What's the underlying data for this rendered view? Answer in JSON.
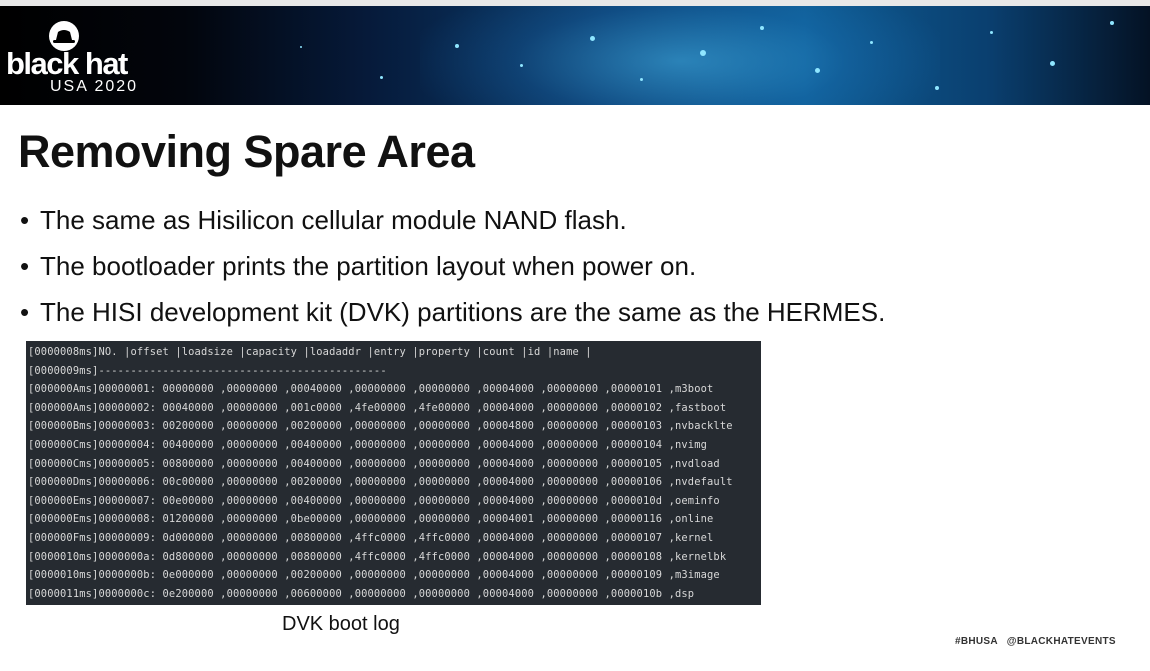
{
  "header": {
    "logo_wordmark": "black hat",
    "logo_event": "USA 2020",
    "logo_icon": "blackhat-hat-icon"
  },
  "slide": {
    "title": "Removing Spare Area",
    "bullets": [
      "The same as Hisilicon cellular module NAND flash.",
      "The bootloader prints the partition layout when power on.",
      "The HISI development kit (DVK) partitions are the same as the HERMES."
    ],
    "bullet_glyph": "•",
    "log_lines": [
      "[0000008ms]NO. |offset |loadsize |capacity |loadaddr |entry |property |count |id |name |",
      "[0000009ms]---------------------------------------------",
      "[000000Ams]00000001: 00000000 ,00000000 ,00040000 ,00000000 ,00000000 ,00004000 ,00000000 ,00000101 ,m3boot",
      "[000000Ams]00000002: 00040000 ,00000000 ,001c0000 ,4fe00000 ,4fe00000 ,00004000 ,00000000 ,00000102 ,fastboot",
      "[000000Bms]00000003: 00200000 ,00000000 ,00200000 ,00000000 ,00000000 ,00004800 ,00000000 ,00000103 ,nvbacklte",
      "[000000Cms]00000004: 00400000 ,00000000 ,00400000 ,00000000 ,00000000 ,00004000 ,00000000 ,00000104 ,nvimg",
      "[000000Cms]00000005: 00800000 ,00000000 ,00400000 ,00000000 ,00000000 ,00004000 ,00000000 ,00000105 ,nvdload",
      "[000000Dms]00000006: 00c00000 ,00000000 ,00200000 ,00000000 ,00000000 ,00004000 ,00000000 ,00000106 ,nvdefault",
      "[000000Ems]00000007: 00e00000 ,00000000 ,00400000 ,00000000 ,00000000 ,00004000 ,00000000 ,0000010d ,oeminfo",
      "[000000Ems]00000008: 01200000 ,00000000 ,0be00000 ,00000000 ,00000000 ,00004001 ,00000000 ,00000116 ,online",
      "[000000Fms]00000009: 0d000000 ,00000000 ,00800000 ,4ffc0000 ,4ffc0000 ,00004000 ,00000000 ,00000107 ,kernel",
      "[0000010ms]0000000a: 0d800000 ,00000000 ,00800000 ,4ffc0000 ,4ffc0000 ,00004000 ,00000000 ,00000108 ,kernelbk",
      "[0000010ms]0000000b: 0e000000 ,00000000 ,00200000 ,00000000 ,00000000 ,00004000 ,00000000 ,00000109 ,m3image",
      "[0000011ms]0000000c: 0e200000 ,00000000 ,00600000 ,00000000 ,00000000 ,00004000 ,00000000 ,0000010b ,dsp"
    ],
    "caption": "DVK boot log"
  },
  "footer": {
    "text": "#BHUSA   @BLACKHATEVENTS"
  },
  "colors": {
    "header_dark": "#000000",
    "header_blue": "#0e5c94",
    "terminal_bg": "#262b31",
    "terminal_text": "#d8d8d8",
    "text": "#111111"
  }
}
